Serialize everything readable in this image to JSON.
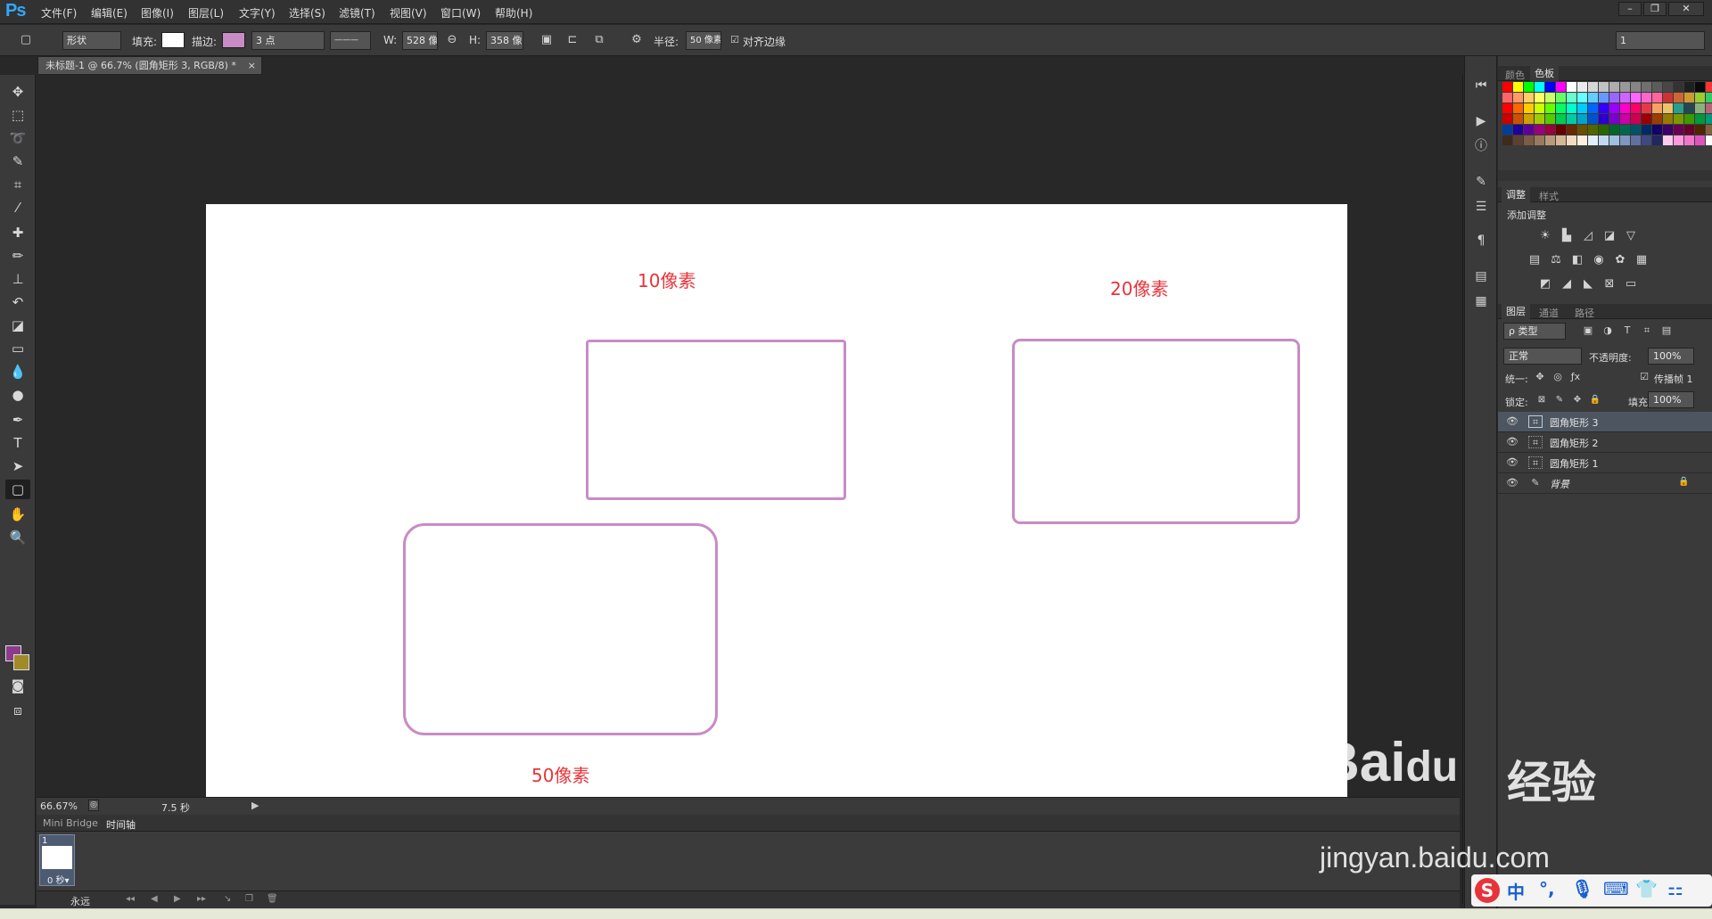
{
  "app": {
    "logo": "Ps"
  },
  "menu": [
    "文件(F)",
    "编辑(E)",
    "图像(I)",
    "图层(L)",
    "文字(Y)",
    "选择(S)",
    "滤镜(T)",
    "视图(V)",
    "窗口(W)",
    "帮助(H)"
  ],
  "window_controls": [
    "–",
    "❐",
    "✕"
  ],
  "options": {
    "mode": "形状",
    "fill_label": "填充:",
    "stroke_label": "描边:",
    "stroke_width": "3 点",
    "w_label": "W:",
    "w_value": "528 像",
    "h_label": "H:",
    "h_value": "358 像",
    "radius_label": "半径:",
    "radius_value": "50 像素",
    "align_label": "对齐边缘",
    "workspace_value": "1",
    "fill_color": "#ffffff",
    "stroke_color": "#c98bc6"
  },
  "document": {
    "tab_title": "未标题-1 @ 66.7% (圆角矩形 3, RGB/8) *",
    "close": "×"
  },
  "canvas": {
    "labels": [
      "10像素",
      "20像素",
      "50像素"
    ],
    "stroke_color": "#c98bc6",
    "label_color": "#e8333a"
  },
  "status": {
    "zoom": "66.67%",
    "time": "7.5 秒"
  },
  "timeline": {
    "tabs": [
      "Mini Bridge",
      "时间轴"
    ],
    "frame_number": "1",
    "frame_delay": "0 秒▾",
    "loop": "永远"
  },
  "panels": {
    "color_tabs": [
      "颜色",
      "色板"
    ],
    "adjust_tabs": [
      "调整",
      "样式"
    ],
    "adjust_title": "添加调整",
    "layer_tabs": [
      "图层",
      "通道",
      "路径"
    ],
    "filter_kind": "ρ 类型",
    "blend_mode": "正常",
    "opacity_label": "不透明度:",
    "opacity_value": "100%",
    "unify_label": "统一:",
    "propagate_label": "传播帧 1",
    "lock_label": "锁定:",
    "fill_label": "填充:",
    "fill_value": "100%"
  },
  "layers": [
    {
      "name": "圆角矩形 3",
      "selected": true
    },
    {
      "name": "圆角矩形 2",
      "selected": false
    },
    {
      "name": "圆角矩形 1",
      "selected": false
    },
    {
      "name": "背景",
      "selected": false
    }
  ],
  "swatches": [
    "#ff0000",
    "#ffff00",
    "#00ff00",
    "#00ffff",
    "#0000ff",
    "#ff00ff",
    "#ffffff",
    "#ebebeb",
    "#d6d6d6",
    "#c2c2c2",
    "#adadad",
    "#999999",
    "#858585",
    "#707070",
    "#5c5c5c",
    "#474747",
    "#333333",
    "#1f1f1f",
    "#0a0a0a",
    "#ff3333",
    "#ffcc00",
    "#ff6666",
    "#ff9966",
    "#ffcc66",
    "#ffff66",
    "#ccff66",
    "#66ff66",
    "#66ffcc",
    "#66ffff",
    "#66ccff",
    "#6699ff",
    "#9966ff",
    "#cc66ff",
    "#ff66ff",
    "#ff66cc",
    "#ff6699",
    "#cc3333",
    "#cc6633",
    "#cc9933",
    "#99cc33",
    "#33cc66",
    "#33cccc",
    "#ff0000",
    "#ff6600",
    "#ffcc00",
    "#ccff00",
    "#66ff00",
    "#00ff66",
    "#00ffcc",
    "#00ccff",
    "#0066ff",
    "#3300ff",
    "#9900ff",
    "#ff00cc",
    "#ff0066",
    "#e63946",
    "#f4a261",
    "#e9c46a",
    "#2a9d8f",
    "#264653",
    "#8ab17d",
    "#b56576",
    "#6d597a",
    "#cc0000",
    "#cc5200",
    "#cca300",
    "#a3cc00",
    "#52cc00",
    "#00cc52",
    "#00cca3",
    "#00a3cc",
    "#0052cc",
    "#2900cc",
    "#7a00cc",
    "#cc00a3",
    "#cc0052",
    "#990000",
    "#993d00",
    "#997a00",
    "#7a9900",
    "#3d9900",
    "#00993d",
    "#00997a",
    "#007a99",
    "#003d99",
    "#1f0099",
    "#5c0099",
    "#99007a",
    "#99003d",
    "#660000",
    "#662900",
    "#665200",
    "#526600",
    "#296600",
    "#006629",
    "#006652",
    "#005266",
    "#002966",
    "#140066",
    "#3d0066",
    "#660052",
    "#660029",
    "#4d2600",
    "#806040",
    "#a08060",
    "#3d2b1f",
    "#5c4033",
    "#7a5c47",
    "#997a5c",
    "#b89a7a",
    "#d4b896",
    "#f0dcc0",
    "#fff0e0",
    "#e0f0ff",
    "#c0d8f0",
    "#a0c0e0",
    "#8098c0",
    "#6070a0",
    "#404880",
    "#202860",
    "#ffccee",
    "#ff99dd",
    "#ee77cc",
    "#dd55bb",
    "#ffffff",
    "#eeeeee"
  ],
  "ime": {
    "brand": "S",
    "items": [
      "中",
      "°,",
      "🎙",
      "⌨",
      "👕",
      "⚏"
    ]
  },
  "watermark": {
    "logo": "Bai",
    "logo_du": "du",
    "jingyan": "经验",
    "url": "jingyan.baidu.com"
  }
}
